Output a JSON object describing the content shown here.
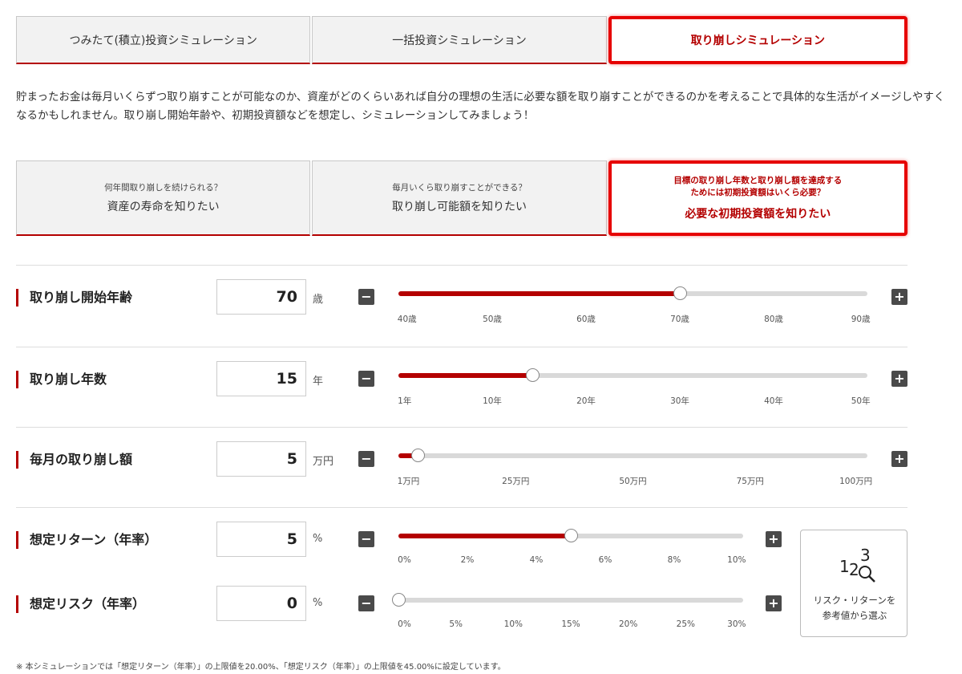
{
  "tabs": [
    {
      "label": "つみたて(積立)投資シミュレーション",
      "active": false
    },
    {
      "label": "一括投資シミュレーション",
      "active": false
    },
    {
      "label": "取り崩しシミュレーション",
      "active": true
    }
  ],
  "intro": "貯まったお金は毎月いくらずつ取り崩すことが可能なのか、資産がどのくらいあれば自分の理想の生活に必要な額を取り崩すことができるのかを考えることで具体的な生活がイメージしやすくなるかもしれません。取り崩し開始年齢や、初期投資額などを想定し、シミュレーションしてみましょう！",
  "subtabs": [
    {
      "question": "何年間取り崩しを続けられる？",
      "answer": "資産の寿命を知りたい",
      "active": false
    },
    {
      "question": "毎月いくら取り崩すことができる？",
      "answer": "取り崩し可能額を知りたい",
      "active": false
    },
    {
      "question": "目標の取り崩し年数と取り崩し額を達成する\nためには初期投資額はいくら必要？",
      "answer": "必要な初期投資額を知りたい",
      "active": true
    }
  ],
  "fields": {
    "start_age": {
      "label": "取り崩し開始年齢",
      "value": "70",
      "unit": "歳",
      "fraction": 0.6,
      "ticks": [
        "40歳",
        "50歳",
        "60歳",
        "70歳",
        "80歳",
        "90歳"
      ]
    },
    "years": {
      "label": "取り崩し年数",
      "value": "15",
      "unit": "年",
      "fraction": 0.2857,
      "ticks": [
        "1年",
        "10年",
        "20年",
        "30年",
        "40年",
        "50年"
      ]
    },
    "monthly": {
      "label": "毎月の取り崩し額",
      "value": "5",
      "unit": "万円",
      "fraction": 0.0404,
      "ticks": [
        "1万円",
        "25万円",
        "50万円",
        "75万円",
        "100万円"
      ]
    },
    "return": {
      "label": "想定リターン（年率）",
      "value": "5",
      "unit": "%",
      "fraction": 0.5,
      "ticks": [
        "0%",
        "2%",
        "4%",
        "6%",
        "8%",
        "10%"
      ]
    },
    "risk": {
      "label": "想定リスク（年率）",
      "value": "0",
      "unit": "%",
      "fraction": 0,
      "ticks": [
        "0%",
        "5%",
        "10%",
        "15%",
        "20%",
        "25%",
        "30%"
      ]
    }
  },
  "buttons": {
    "minus": "−",
    "plus": "+"
  },
  "reference": {
    "line1": "リスク・リターンを",
    "line2": "参考値から選ぶ",
    "icon": "123-magnifier-icon"
  },
  "note": "※ 本シミュレーションでは「想定リターン（年率）」の上限値を20.00%、「想定リスク（年率）」の上限値を45.00%に設定しています。",
  "colors": {
    "accent": "#b40000",
    "highlight": "#e60000",
    "track": "#d9d9d9"
  }
}
